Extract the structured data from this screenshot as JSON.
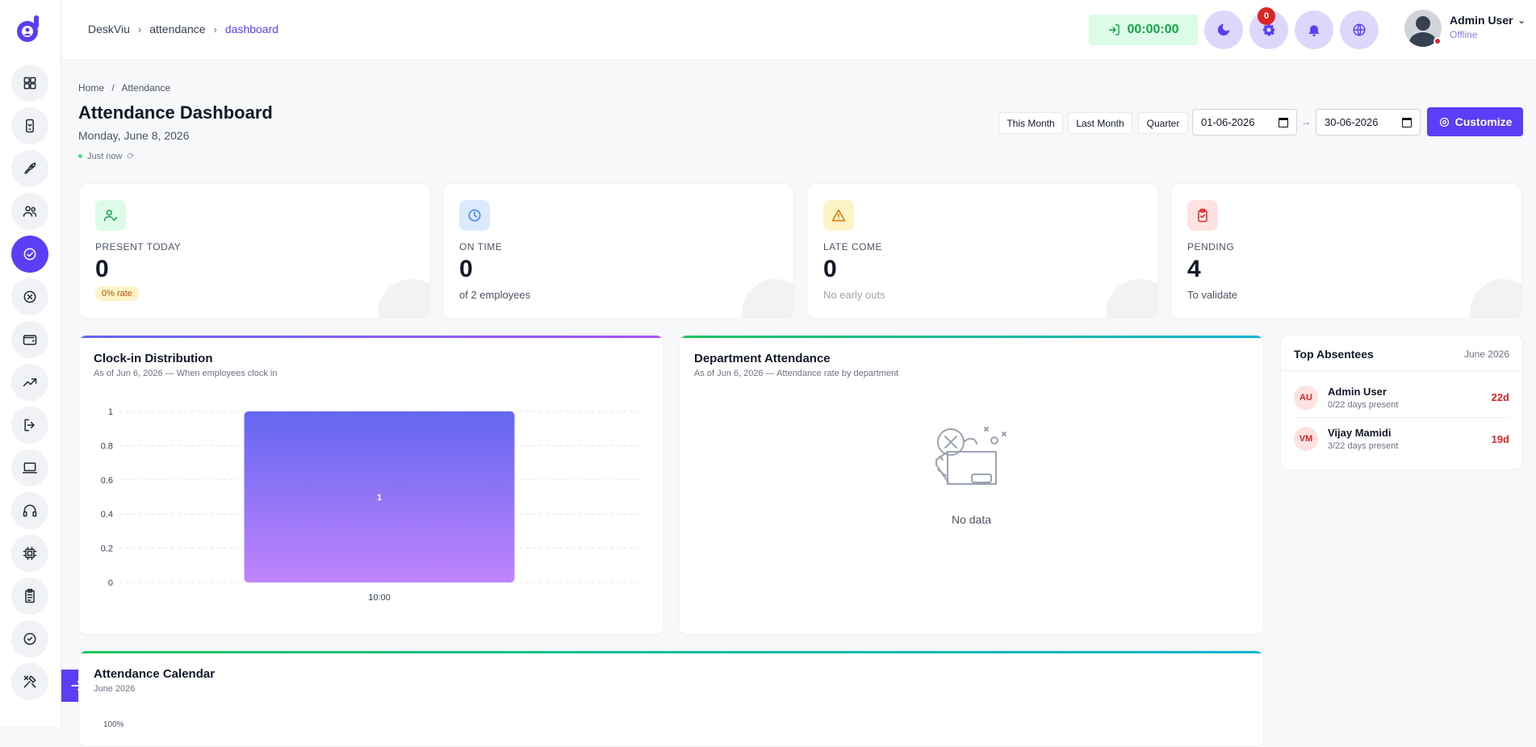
{
  "topbar": {
    "breadcrumb": [
      "DeskViu",
      "attendance",
      "dashboard"
    ],
    "timer": "00:00:00",
    "notif_count": "0",
    "user_name": "Admin User",
    "user_status": "Offline"
  },
  "sidebar": {
    "items": [
      "dashboard-icon",
      "mobile-icon",
      "rocket-icon",
      "users-icon",
      "attendance-icon",
      "close-circle-icon",
      "wallet-icon",
      "trend-icon",
      "logout-icon",
      "laptop-icon",
      "headset-icon",
      "chip-icon",
      "clipboard-icon",
      "check-circle-icon",
      "tools-icon"
    ],
    "active_index": 4
  },
  "page": {
    "breadcrumb_home": "Home",
    "breadcrumb_sep": "/",
    "breadcrumb_current": "Attendance",
    "title": "Attendance Dashboard",
    "date": "Monday, June 8, 2026",
    "updated": "Just now"
  },
  "filters": {
    "this_month": "This Month",
    "last_month": "Last Month",
    "quarter": "Quarter",
    "from": "01-06-2026",
    "to": "30-06-2026",
    "range_sep": "→",
    "customize": "Customize"
  },
  "stats": [
    {
      "label": "PRESENT TODAY",
      "value": "0",
      "sub": "0% rate",
      "color": "#16a34a",
      "bg": "#dcfce7"
    },
    {
      "label": "ON TIME",
      "value": "0",
      "sub": "of 2 employees",
      "color": "#3b82f6",
      "bg": "#dbeafe"
    },
    {
      "label": "LATE COME",
      "value": "0",
      "sub": "No early outs",
      "color": "#d97706",
      "bg": "#fef3c7"
    },
    {
      "label": "PENDING",
      "value": "4",
      "sub": "To validate",
      "color": "#dc2626",
      "bg": "#fee2e2"
    }
  ],
  "clockin": {
    "title": "Clock-in Distribution",
    "subtitle": "As of Jun 6, 2026 — When employees clock in"
  },
  "department": {
    "title": "Department Attendance",
    "subtitle": "As of Jun 6, 2026 — Attendance rate by department",
    "empty": "No data"
  },
  "absentees": {
    "title": "Top Absentees",
    "month": "June 2026",
    "rows": [
      {
        "initials": "AU",
        "name": "Admin User",
        "days": "0/22 days present",
        "count": "22d"
      },
      {
        "initials": "VM",
        "name": "Vijay Mamidi",
        "days": "3/22 days present",
        "count": "19d"
      }
    ]
  },
  "calendar": {
    "title": "Attendance Calendar",
    "subtitle": "June 2026",
    "first_tick": "100%"
  },
  "chart_data": {
    "type": "bar",
    "title": "Clock-in Distribution",
    "categories": [
      "10:00"
    ],
    "values": [
      1
    ],
    "ylim": [
      0,
      1
    ],
    "yticks": [
      "0",
      "0.2",
      "0.4",
      "0.6",
      "0.8",
      "1"
    ],
    "grid": true,
    "bar_color_top": "#6366f1",
    "bar_color_bottom": "#c084fc"
  }
}
